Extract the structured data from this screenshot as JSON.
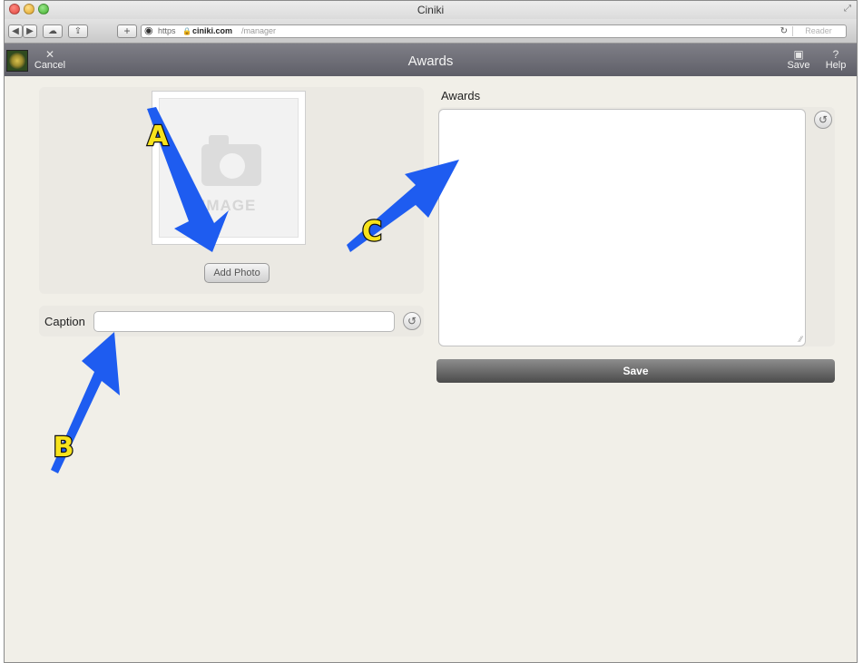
{
  "browser": {
    "window_title": "Ciniki",
    "url_scheme": "https",
    "url_domain": "ciniki.com",
    "url_path": "/manager",
    "reader_label": "Reader",
    "toolbar_icons": [
      "back-icon",
      "forward-icon",
      "cloud-icon",
      "share-icon",
      "add-tab-icon"
    ]
  },
  "app": {
    "title": "Awards",
    "cancel_label": "Cancel",
    "save_label": "Save",
    "help_label": "Help"
  },
  "photo": {
    "placeholder_text": "IMAGE",
    "add_photo_label": "Add Photo"
  },
  "caption": {
    "label": "Caption",
    "value": ""
  },
  "awards": {
    "label": "Awards",
    "value": ""
  },
  "form": {
    "save_label": "Save"
  },
  "annotations": {
    "callouts": [
      "A",
      "B",
      "C"
    ],
    "arrow_color": "#1e5cf0",
    "callout_fill": "#f7e31c"
  },
  "colors": {
    "app_header": "#6b6b74",
    "page_background": "#f1efe8",
    "panel_background": "#ebe9e3",
    "save_button": "#5e5e5e"
  }
}
